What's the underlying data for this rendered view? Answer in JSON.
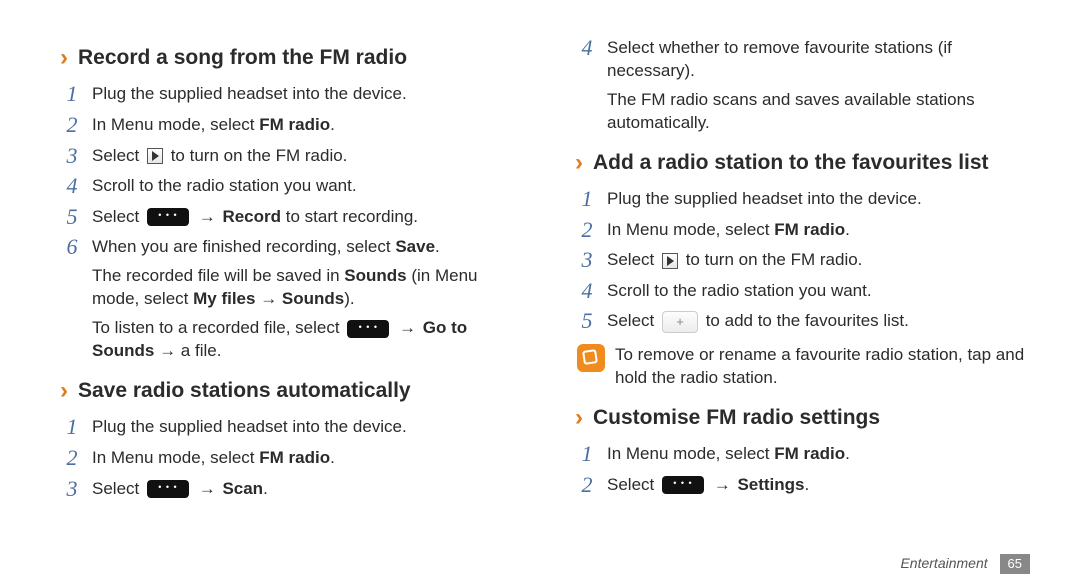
{
  "left": {
    "sec1": {
      "title": "Record a song from the FM radio",
      "s1": {
        "n": "1",
        "t": "Plug the supplied headset into the device."
      },
      "s2": {
        "n": "2",
        "a": "In Menu mode, select ",
        "b": "FM radio",
        "c": "."
      },
      "s3": {
        "n": "3",
        "a": "Select ",
        "b": " to turn on the FM radio."
      },
      "s4": {
        "n": "4",
        "t": "Scroll to the radio station you want."
      },
      "s5": {
        "n": "5",
        "a": "Select ",
        "arrow": " → ",
        "b": "Record",
        "c": " to start recording."
      },
      "s6": {
        "n": "6",
        "a": "When you are finished recording, select ",
        "b": "Save",
        "c": ".",
        "sub1a": "The recorded file will be saved in ",
        "sub1b": "Sounds",
        "sub1c": " (in Menu mode, select ",
        "sub1d": "My files → Sounds",
        "sub1e": ").",
        "sub2a": "To listen to a recorded file, select ",
        "sub2arrow": " → ",
        "sub2b": "Go to Sounds",
        "sub2c": " → a file."
      }
    },
    "sec2": {
      "title": "Save radio stations automatically",
      "s1": {
        "n": "1",
        "t": "Plug the supplied headset into the device."
      },
      "s2": {
        "n": "2",
        "a": "In Menu mode, select ",
        "b": "FM radio",
        "c": "."
      },
      "s3": {
        "n": "3",
        "a": "Select ",
        "arrow": " → ",
        "b": "Scan",
        "c": "."
      }
    }
  },
  "right": {
    "cont": {
      "s4": {
        "n": "4",
        "a": "Select whether to remove favourite stations (if necessary).",
        "sub": "The FM radio scans and saves available stations automatically."
      }
    },
    "sec3": {
      "title": "Add a radio station to the favourites list",
      "s1": {
        "n": "1",
        "t": "Plug the supplied headset into the device."
      },
      "s2": {
        "n": "2",
        "a": "In Menu mode, select ",
        "b": "FM radio",
        "c": "."
      },
      "s3": {
        "n": "3",
        "a": "Select ",
        "b": " to turn on the FM radio."
      },
      "s4": {
        "n": "4",
        "t": "Scroll to the radio station you want."
      },
      "s5": {
        "n": "5",
        "a": "Select ",
        "b": " to add to the favourites list."
      },
      "note": "To remove or rename a favourite radio station, tap and hold the radio station."
    },
    "sec4": {
      "title": "Customise FM radio settings",
      "s1": {
        "n": "1",
        "a": "In Menu mode, select ",
        "b": "FM radio",
        "c": "."
      },
      "s2": {
        "n": "2",
        "a": "Select ",
        "arrow": " → ",
        "b": "Settings",
        "c": "."
      }
    }
  },
  "footer": {
    "cat": "Entertainment",
    "page": "65"
  }
}
